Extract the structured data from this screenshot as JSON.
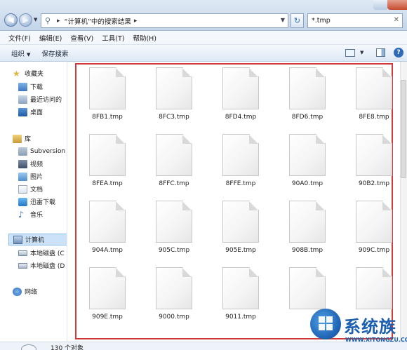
{
  "address": {
    "path": "“计算机”中的搜索结果",
    "search_value": "*.tmp"
  },
  "menu": [
    {
      "label": "文件(F)"
    },
    {
      "label": "编辑(E)"
    },
    {
      "label": "查看(V)"
    },
    {
      "label": "工具(T)"
    },
    {
      "label": "帮助(H)"
    }
  ],
  "commands": {
    "organize": "组织",
    "save_search": "保存搜索"
  },
  "nav": {
    "favorites": "收藏夹",
    "downloads": "下载",
    "recent": "最近访问的",
    "desktop": "桌面",
    "libraries": "库",
    "subversion": "Subversion",
    "videos": "视频",
    "pictures": "图片",
    "documents": "文档",
    "xunlei": "迅雷下载",
    "music": "音乐",
    "computer": "计算机",
    "disk_c": "本地磁盘 (C",
    "disk_d": "本地磁盘 (D",
    "network": "网络"
  },
  "files": [
    "8FB1.tmp",
    "8FC3.tmp",
    "8FD4.tmp",
    "8FD6.tmp",
    "8FE8.tmp",
    "8FEA.tmp",
    "8FFC.tmp",
    "8FFE.tmp",
    "90A0.tmp",
    "90B2.tmp",
    "904A.tmp",
    "905C.tmp",
    "905E.tmp",
    "908B.tmp",
    "909C.tmp",
    "909E.tmp",
    "9000.tmp",
    "9011.tmp",
    "",
    ""
  ],
  "status": {
    "count_text": "130 个对象"
  },
  "watermark": {
    "brand": "系统族",
    "url": "WWW.XITONGZU.COM"
  }
}
